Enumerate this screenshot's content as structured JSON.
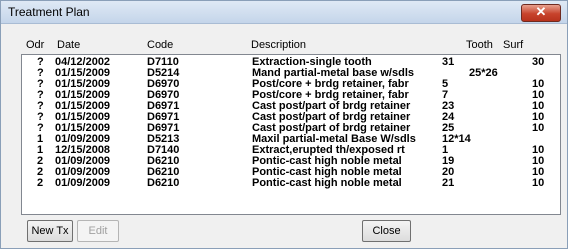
{
  "window": {
    "title": "Treatment Plan",
    "close_glyph": "✕"
  },
  "columns": {
    "odr": "Odr",
    "date": "Date",
    "code": "Code",
    "description": "Description",
    "tooth": "Tooth",
    "surf": "Surf"
  },
  "rows": [
    {
      "odr": "?",
      "date": "04/12/2002",
      "code": "D7110",
      "description": "Extraction-single tooth",
      "tooth": "31",
      "surf": "30"
    },
    {
      "odr": "?",
      "date": "01/15/2009",
      "code": "D5214",
      "description": "Mand partial-metal base w/sdls",
      "tooth": "25*26",
      "surf": ""
    },
    {
      "odr": "?",
      "date": "01/15/2009",
      "code": "D6970",
      "description": "Post/core + brdg retainer, fabr",
      "tooth": "5",
      "surf": "10"
    },
    {
      "odr": "?",
      "date": "01/15/2009",
      "code": "D6970",
      "description": "Post/core + brdg retainer, fabr",
      "tooth": "7",
      "surf": "10"
    },
    {
      "odr": "?",
      "date": "01/15/2009",
      "code": "D6971",
      "description": "Cast post/part of brdg retainer",
      "tooth": "23",
      "surf": "10"
    },
    {
      "odr": "?",
      "date": "01/15/2009",
      "code": "D6971",
      "description": "Cast post/part of brdg retainer",
      "tooth": "24",
      "surf": "10"
    },
    {
      "odr": "?",
      "date": "01/15/2009",
      "code": "D6971",
      "description": "Cast post/part of brdg retainer",
      "tooth": "25",
      "surf": "10"
    },
    {
      "odr": "1",
      "date": "01/09/2009",
      "code": "D5213",
      "description": "Maxil partial-metal Base W/sdls",
      "tooth": "12*14",
      "surf": ""
    },
    {
      "odr": "1",
      "date": "12/15/2008",
      "code": "D7140",
      "description": "Extract,erupted th/exposed rt",
      "tooth": "1",
      "surf": "10"
    },
    {
      "odr": "2",
      "date": "01/09/2009",
      "code": "D6210",
      "description": "Pontic-cast high noble metal",
      "tooth": "19",
      "surf": "10"
    },
    {
      "odr": "2",
      "date": "01/09/2009",
      "code": "D6210",
      "description": "Pontic-cast high noble metal",
      "tooth": "20",
      "surf": "10"
    },
    {
      "odr": "2",
      "date": "01/09/2009",
      "code": "D6210",
      "description": "Pontic-cast high noble metal",
      "tooth": "21",
      "surf": "10"
    }
  ],
  "buttons": {
    "new_tx": "New Tx",
    "edit": "Edit",
    "close": "Close"
  }
}
